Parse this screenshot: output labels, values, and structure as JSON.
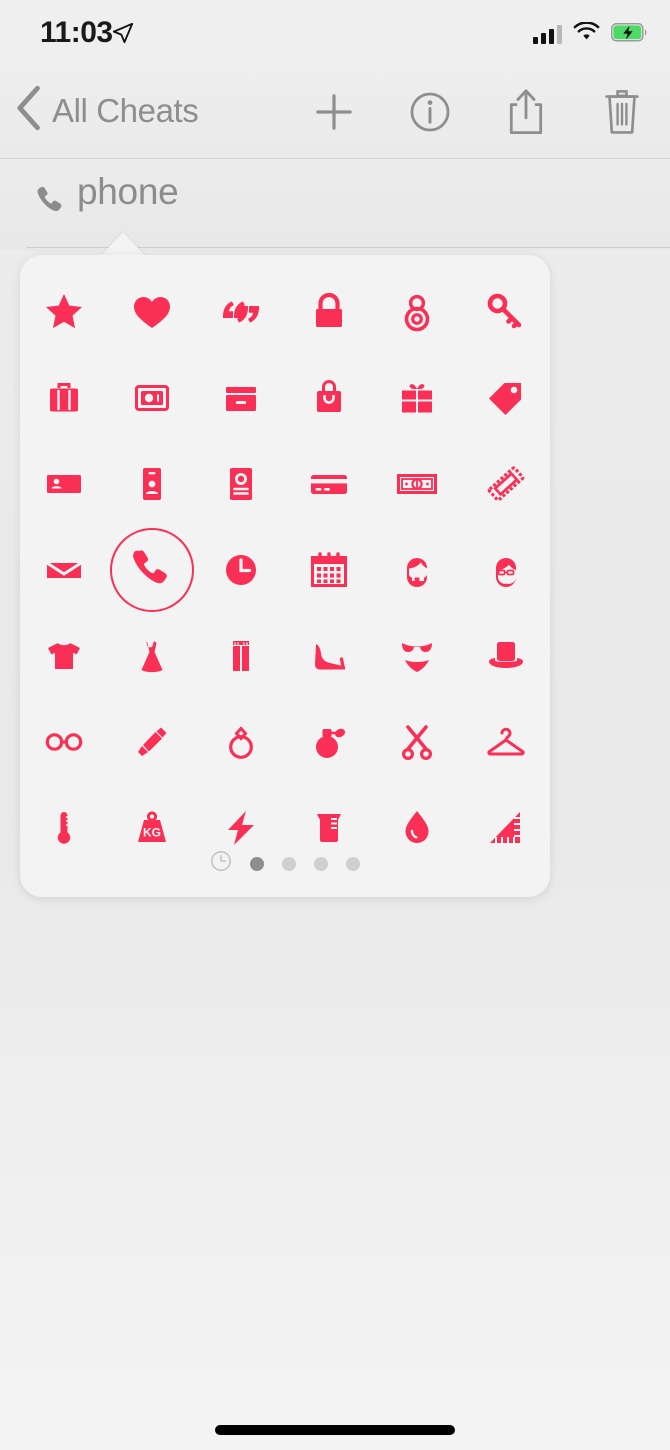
{
  "status_bar": {
    "time": "11:03",
    "location_icon": "location-arrow-icon",
    "cellular_icon": "cellular-bars-icon",
    "cellular_bars_filled": 3,
    "cellular_bars_total": 4,
    "wifi_icon": "wifi-icon",
    "battery_icon": "battery-charging-icon",
    "battery_charging": true,
    "battery_color": "#4CD964"
  },
  "nav_bar": {
    "back_label": "All Cheats",
    "back_icon": "chevron-left-icon",
    "actions": [
      {
        "name": "add-button",
        "icon": "plus-icon"
      },
      {
        "name": "info-button",
        "icon": "info-circle-icon"
      },
      {
        "name": "share-button",
        "icon": "share-icon"
      },
      {
        "name": "delete-button",
        "icon": "trash-icon"
      }
    ]
  },
  "field": {
    "icon": "phone-icon",
    "value": "phone",
    "placeholder": "phone",
    "text_color": "#8C8C8C"
  },
  "popover": {
    "accent_color": "#FA2F56",
    "background_color": "#F3F3F3",
    "selected_icon": "phone-handset-icon",
    "icons": [
      {
        "name": "star-icon",
        "label": "Star"
      },
      {
        "name": "heart-icon",
        "label": "Heart"
      },
      {
        "name": "quotation-marks-icon",
        "label": "Quotation Marks"
      },
      {
        "name": "padlock-icon",
        "label": "Padlock"
      },
      {
        "name": "combination-lock-icon",
        "label": "Combination Lock"
      },
      {
        "name": "key-icon",
        "label": "Key"
      },
      {
        "name": "suitcase-icon",
        "label": "Suitcase"
      },
      {
        "name": "safe-icon",
        "label": "Safe"
      },
      {
        "name": "archive-box-icon",
        "label": "Archive Box"
      },
      {
        "name": "shopping-bag-icon",
        "label": "Shopping Bag"
      },
      {
        "name": "gift-icon",
        "label": "Gift"
      },
      {
        "name": "price-tag-icon",
        "label": "Price Tag"
      },
      {
        "name": "business-card-icon",
        "label": "Business Card"
      },
      {
        "name": "id-badge-icon",
        "label": "ID Badge"
      },
      {
        "name": "contact-card-icon",
        "label": "Contact Card"
      },
      {
        "name": "credit-card-icon",
        "label": "Credit Card"
      },
      {
        "name": "banknote-icon",
        "label": "Banknote"
      },
      {
        "name": "ticket-icon",
        "label": "Ticket"
      },
      {
        "name": "envelope-icon",
        "label": "Envelope"
      },
      {
        "name": "phone-handset-icon",
        "label": "Phone"
      },
      {
        "name": "clock-icon",
        "label": "Clock"
      },
      {
        "name": "calendar-icon",
        "label": "Calendar"
      },
      {
        "name": "bearded-face-icon",
        "label": "Bearded Face"
      },
      {
        "name": "face-with-glasses-icon",
        "label": "Face With Glasses"
      },
      {
        "name": "tshirt-icon",
        "label": "T-Shirt"
      },
      {
        "name": "dress-icon",
        "label": "Dress"
      },
      {
        "name": "jeans-icon",
        "label": "Jeans"
      },
      {
        "name": "high-heel-icon",
        "label": "High Heel"
      },
      {
        "name": "bikini-icon",
        "label": "Bikini"
      },
      {
        "name": "top-hat-icon",
        "label": "Top Hat"
      },
      {
        "name": "eyeglasses-icon",
        "label": "Eyeglasses"
      },
      {
        "name": "lipstick-icon",
        "label": "Lipstick"
      },
      {
        "name": "ring-icon",
        "label": "Ring"
      },
      {
        "name": "perfume-icon",
        "label": "Perfume"
      },
      {
        "name": "scissors-icon",
        "label": "Scissors"
      },
      {
        "name": "hanger-icon",
        "label": "Hanger"
      },
      {
        "name": "thermometer-icon",
        "label": "Thermometer"
      },
      {
        "name": "weight-kg-icon",
        "label": "Weight",
        "text": "KG"
      },
      {
        "name": "lightning-bolt-icon",
        "label": "Lightning Bolt"
      },
      {
        "name": "beaker-icon",
        "label": "Beaker"
      },
      {
        "name": "water-drop-icon",
        "label": "Water Drop"
      },
      {
        "name": "triangle-ruler-icon",
        "label": "Triangle Ruler"
      }
    ],
    "pager": {
      "recents_icon": "clock-outline-icon",
      "dot_count": 4,
      "active_dot_index": 0
    }
  },
  "home_indicator": {
    "name": "home-indicator"
  }
}
